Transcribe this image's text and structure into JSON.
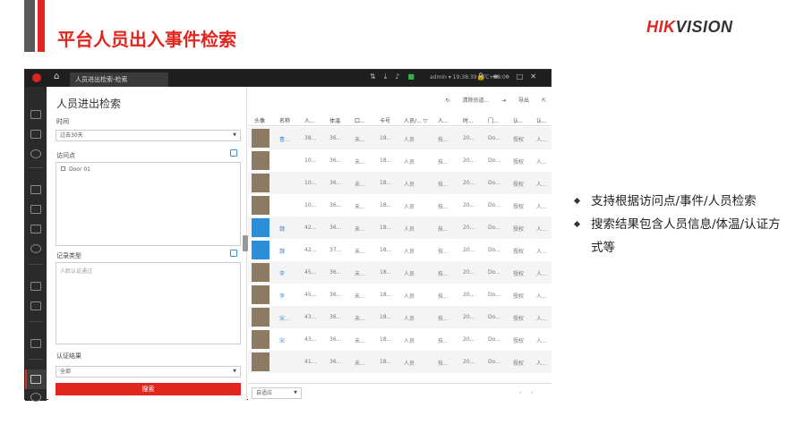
{
  "slide": {
    "title": "平台人员出入事件检索",
    "logo_hik": "HIK",
    "logo_vision": "VISION",
    "bullets": [
      "支持根据访问点/事件/人员检索",
      "搜索结果包含人员信息/体温/认证方式等"
    ]
  },
  "titlebar": {
    "tab_label": "人员进出检索-检索",
    "user": "admin ▾  19:38:39 UTC+08:00"
  },
  "left_panel": {
    "title": "人员进出检索",
    "time_label": "时间",
    "time_value": "过去30天",
    "access_point_label": "访问点",
    "door_item": "Door 01",
    "record_type_label": "记录类型",
    "record_type_placeholder": "人脸认证通过",
    "auth_result_label": "认证结果",
    "auth_result_value": "全部",
    "search_button": "搜索"
  },
  "right_panel": {
    "clear_label": "清除员道...",
    "export_label": "导出",
    "columns": [
      "头像",
      "名称",
      "人...",
      "体温",
      "口...",
      "卡号",
      "人员/... ▽",
      "人...",
      "时...",
      "门...",
      "认...",
      "认..."
    ],
    "rows": [
      {
        "name": "曹...",
        "id": "38...",
        "temp": "36...",
        "mask": "未...",
        "card": "18...",
        "type": "人员",
        "dept": "技...",
        "time": "20...",
        "door": "Do...",
        "auth": "授权",
        "method": "人..."
      },
      {
        "name": "",
        "id": "10...",
        "temp": "36...",
        "mask": "未...",
        "card": "18...",
        "type": "人员",
        "dept": "技...",
        "time": "20...",
        "door": "Do...",
        "auth": "授权",
        "method": "人..."
      },
      {
        "name": "",
        "id": "10...",
        "temp": "36...",
        "mask": "未...",
        "card": "18...",
        "type": "人员",
        "dept": "技...",
        "time": "20...",
        "door": "Do...",
        "auth": "授权",
        "method": "人..."
      },
      {
        "name": "",
        "id": "10...",
        "temp": "36...",
        "mask": "未...",
        "card": "18...",
        "type": "人员",
        "dept": "技...",
        "time": "20...",
        "door": "Do...",
        "auth": "授权",
        "method": "人..."
      },
      {
        "name": "魏",
        "id": "42...",
        "temp": "36...",
        "mask": "未...",
        "card": "18...",
        "type": "人员",
        "dept": "技...",
        "time": "20...",
        "door": "Do...",
        "auth": "授权",
        "method": "人..."
      },
      {
        "name": "魏",
        "id": "42...",
        "temp": "37...",
        "mask": "未...",
        "card": "18...",
        "type": "人员",
        "dept": "技...",
        "time": "20...",
        "door": "Do...",
        "auth": "授权",
        "method": "人..."
      },
      {
        "name": "李",
        "id": "45...",
        "temp": "36...",
        "mask": "未...",
        "card": "18...",
        "type": "人员",
        "dept": "技...",
        "time": "20...",
        "door": "Do...",
        "auth": "授权",
        "method": "人..."
      },
      {
        "name": "李",
        "id": "45...",
        "temp": "36...",
        "mask": "未...",
        "card": "18...",
        "type": "人员",
        "dept": "技...",
        "time": "20...",
        "door": "Do...",
        "auth": "授权",
        "method": "人..."
      },
      {
        "name": "宋...",
        "id": "43...",
        "temp": "36...",
        "mask": "未...",
        "card": "18...",
        "type": "人员",
        "dept": "技...",
        "time": "20...",
        "door": "Do...",
        "auth": "授权",
        "method": "人..."
      },
      {
        "name": "宋",
        "id": "43...",
        "temp": "36...",
        "mask": "未...",
        "card": "18...",
        "type": "人员",
        "dept": "技...",
        "time": "20...",
        "door": "Do...",
        "auth": "授权",
        "method": "人..."
      },
      {
        "name": "",
        "id": "41...",
        "temp": "36...",
        "mask": "未...",
        "card": "18...",
        "type": "人员",
        "dept": "技...",
        "time": "20...",
        "door": "Do...",
        "auth": "授权",
        "method": "人..."
      }
    ],
    "page_size": "自适应"
  },
  "colors": {
    "accent": "#e0261e",
    "link": "#4a90d9"
  }
}
